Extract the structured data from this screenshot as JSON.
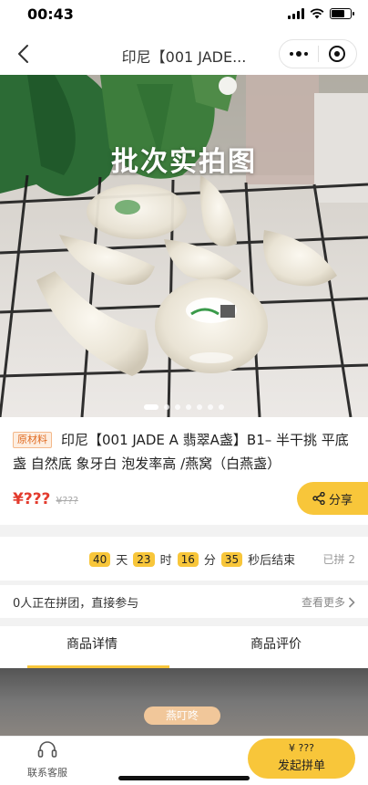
{
  "status": {
    "time": "00:43"
  },
  "nav": {
    "title": "印尼【001 JADE..."
  },
  "hero": {
    "caption": "批次实拍图",
    "slide_count": 7,
    "active_slide": 1
  },
  "product": {
    "tag": "原材料",
    "title": "印尼【001 JADE A 翡翠A盏】B1– 半干挑 平底盏 自然底 象牙白 泡发率高 /燕窝（白燕盏）",
    "price": "¥???",
    "original_price": "¥???",
    "share_label": "分享"
  },
  "countdown": {
    "days": "40",
    "days_unit": "天",
    "hours": "23",
    "hours_unit": "时",
    "minutes": "16",
    "minutes_unit": "分",
    "seconds": "35",
    "seconds_suffix": "秒后结束",
    "joined": "已拼 2"
  },
  "group": {
    "text": "0人正在拼团，直接参与",
    "view_more": "查看更多"
  },
  "tabs": [
    {
      "label": "商品详情",
      "active": true
    },
    {
      "label": "商品评价",
      "active": false
    }
  ],
  "detail": {
    "chip": "燕叮咚"
  },
  "bottom": {
    "service_label": "联系客服",
    "buy_price": "¥ ???",
    "buy_label": "发起拼单"
  },
  "colors": {
    "accent": "#f8c63a",
    "price": "#e33b2e",
    "tag": "#e06a20"
  }
}
